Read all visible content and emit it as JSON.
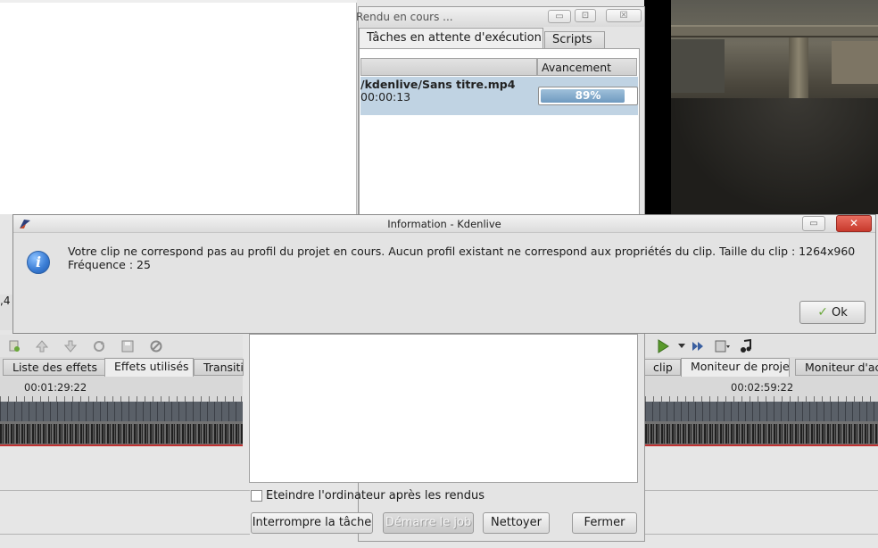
{
  "render_window": {
    "title": "Rendu en cours ...",
    "controls": {
      "minimize": "▭",
      "maximize": "⊡",
      "close": "☒"
    },
    "tabs": [
      {
        "label": "Tâches en attente d'exécution",
        "active": true
      },
      {
        "label": "Scripts",
        "active": false
      }
    ],
    "columns": {
      "file": "",
      "progress": "Avancement"
    },
    "job": {
      "file": "/kdenlive/Sans titre.mp4",
      "time": "00:00:13",
      "progress_percent": 89,
      "progress_label": "89%"
    },
    "shutdown_checkbox": {
      "label": "Eteindre l'ordinateur après les rendus",
      "checked": false
    },
    "buttons": {
      "stop": "Interrompre la tâche",
      "start": "Démarre le job",
      "clean": "Nettoyer",
      "close": "Fermer"
    }
  },
  "info_dialog": {
    "title": "Information - Kdenlive",
    "icon": "information-icon",
    "message_line1": "Votre clip ne correspond pas au profil du projet en cours. Aucun profil existant ne correspond aux propriétés du clip. Taille du clip : 1264x960",
    "message_line2": "Fréquence : 25",
    "ok_label": "Ok",
    "minimize": "▭",
    "close": "✕"
  },
  "kdenlive": {
    "left_fragment": ",4",
    "left_tabs": [
      "Liste des effets",
      "Effets utilisés",
      "Transiti"
    ],
    "right_tabs": [
      "clip",
      "Moniteur de projet",
      "Moniteur d'acq"
    ],
    "left_timecode": "00:01:29:22",
    "right_timecode": "00:02:59:22",
    "left_toolbar_icons": [
      "add-effect-icon",
      "arrow-up-icon",
      "arrow-down-icon",
      "reset-icon",
      "save-icon",
      "disable-icon"
    ],
    "right_toolbar_icons": [
      "play-icon",
      "dropdown-icon",
      "fast-forward-icon",
      "clip-menu-icon",
      "audio-icon"
    ],
    "colors": {
      "accent_selection": "#c0d3e3",
      "timeline_dark": "#5a6068",
      "close_red": "#c8392c"
    }
  }
}
